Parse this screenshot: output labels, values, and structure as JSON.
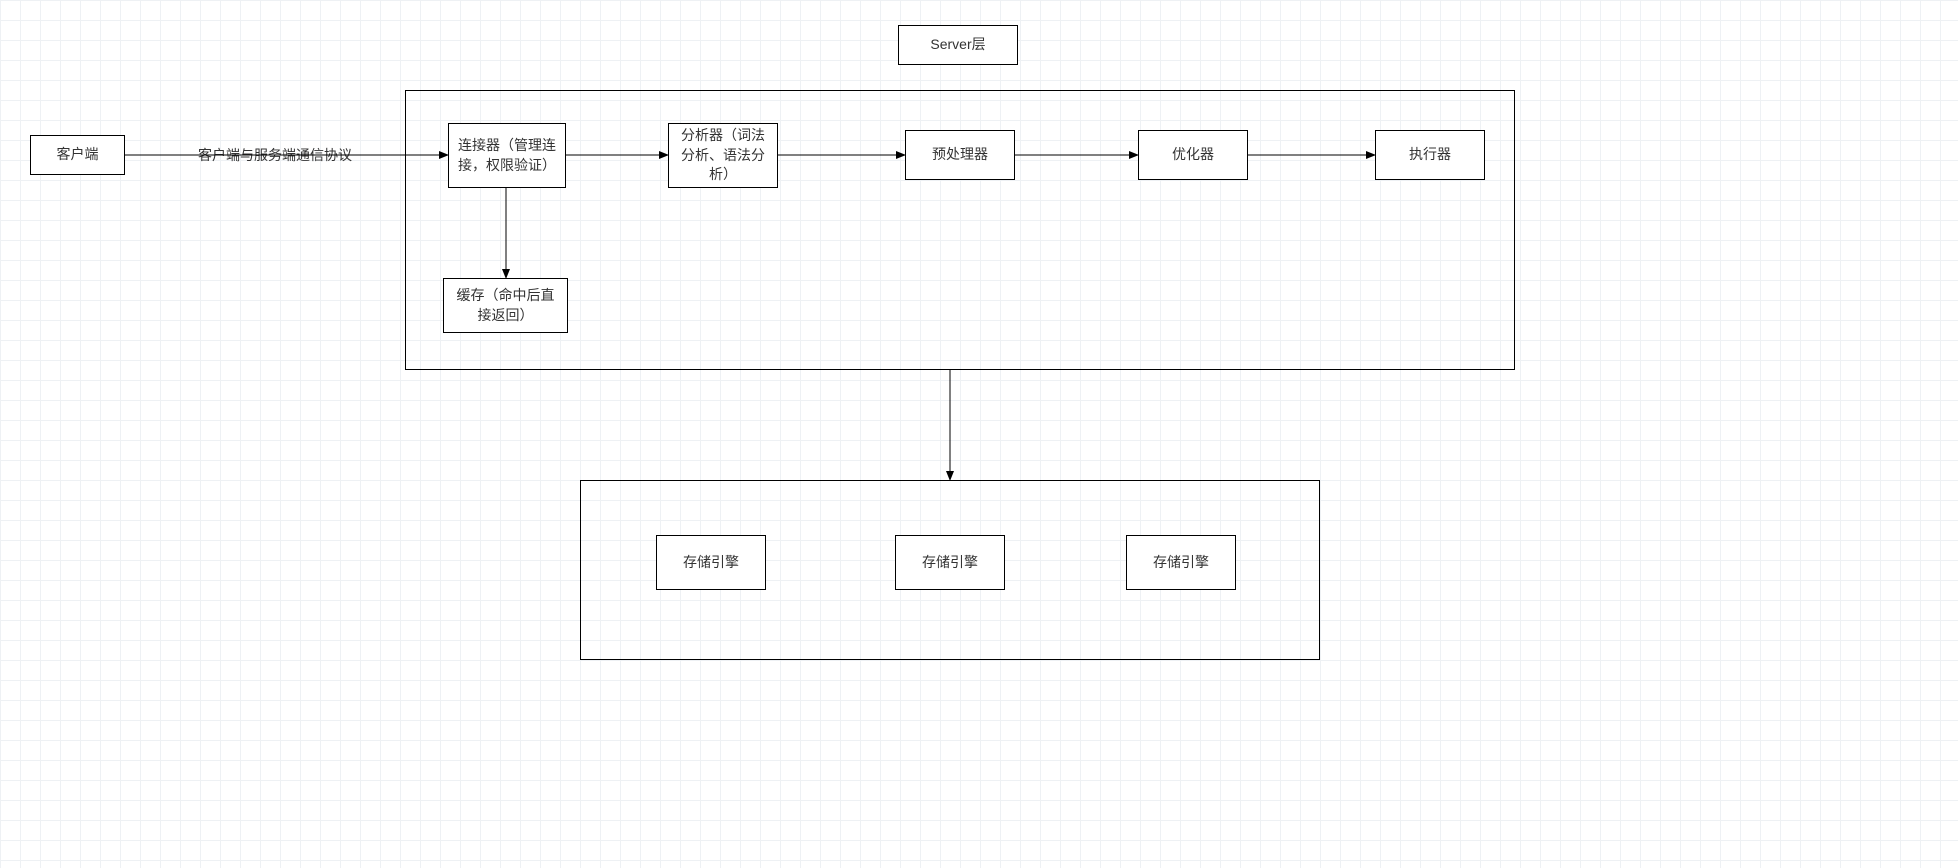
{
  "labels": {
    "server_layer": "Server层",
    "client": "客户端",
    "protocol": "客户端与服务端通信协议",
    "connector": "连接器（管理连接，权限验证）",
    "analyzer": "分析器（词法分析、语法分析）",
    "preprocessor": "预处理器",
    "optimizer": "优化器",
    "executor": "执行器",
    "cache": "缓存（命中后直接返回）",
    "storage1": "存储引擎",
    "storage2": "存储引擎",
    "storage3": "存储引擎"
  }
}
